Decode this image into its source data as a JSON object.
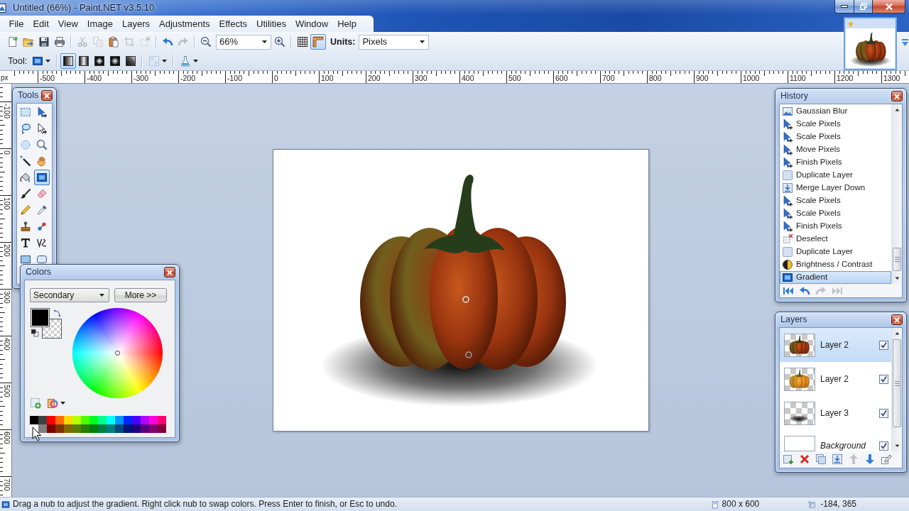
{
  "window": {
    "title": "Untitled (66%) - Paint.NET v3.5.10"
  },
  "menu": [
    "File",
    "Edit",
    "View",
    "Image",
    "Layers",
    "Adjustments",
    "Effects",
    "Utilities",
    "Window",
    "Help"
  ],
  "toolbar": {
    "groups": [
      [
        {
          "kind": "new",
          "disabled": false
        },
        {
          "kind": "open",
          "disabled": false
        },
        {
          "kind": "save",
          "disabled": false
        },
        {
          "kind": "print",
          "disabled": false
        }
      ],
      [
        {
          "kind": "cut",
          "disabled": true
        },
        {
          "kind": "copy",
          "disabled": true
        },
        {
          "kind": "paste",
          "disabled": false
        },
        {
          "kind": "crop",
          "disabled": true
        },
        {
          "kind": "deselect",
          "disabled": true
        }
      ],
      [
        {
          "kind": "undo",
          "disabled": false
        },
        {
          "kind": "redo",
          "disabled": true
        }
      ]
    ],
    "zoom": "66%",
    "grid_on": false,
    "rulers_on": true,
    "units_label": "Units:",
    "units": "Pixels"
  },
  "tool_options": {
    "label": "Tool:",
    "gradient_types": [
      {
        "kind": "linear",
        "selected": true
      },
      {
        "kind": "reflected",
        "selected": false
      },
      {
        "kind": "diamond",
        "selected": false
      },
      {
        "kind": "radial",
        "selected": false
      },
      {
        "kind": "conical",
        "selected": false
      }
    ]
  },
  "rulers": {
    "unit": "px",
    "horizontal": [
      "-500",
      "-400",
      "-300",
      "-200",
      "-100",
      "0",
      "100",
      "200",
      "300",
      "400",
      "500",
      "600",
      "700",
      "800",
      "900",
      "1000",
      "1100",
      "1200",
      "1300"
    ],
    "vertical": [
      "-100",
      "0",
      "100",
      "200",
      "300",
      "400",
      "500",
      "600",
      "700"
    ]
  },
  "tools_window": {
    "title": "Tools",
    "tools": [
      {
        "kind": "rectangle-select",
        "selected": false
      },
      {
        "kind": "move-pixels",
        "selected": false
      },
      {
        "kind": "lasso-select",
        "selected": false
      },
      {
        "kind": "move-selection",
        "selected": false
      },
      {
        "kind": "ellipse-select",
        "selected": false
      },
      {
        "kind": "zoom",
        "selected": false
      },
      {
        "kind": "magic-wand",
        "selected": false
      },
      {
        "kind": "pan",
        "selected": false
      },
      {
        "kind": "paint-bucket",
        "selected": false
      },
      {
        "kind": "gradient",
        "selected": true
      },
      {
        "kind": "paintbrush",
        "selected": false
      },
      {
        "kind": "eraser",
        "selected": false
      },
      {
        "kind": "pencil",
        "selected": false
      },
      {
        "kind": "color-picker",
        "selected": false
      },
      {
        "kind": "clone-stamp",
        "selected": false
      },
      {
        "kind": "recolor",
        "selected": false
      },
      {
        "kind": "text",
        "selected": false
      },
      {
        "kind": "line-curve",
        "selected": false
      },
      {
        "kind": "rectangle",
        "selected": false
      },
      {
        "kind": "rounded-rectangle",
        "selected": false
      }
    ]
  },
  "colors_window": {
    "title": "Colors",
    "mode": "Secondary",
    "more_button": "More >>",
    "palette": [
      {
        "color": "#000000"
      },
      {
        "color": "#404040"
      },
      {
        "color": "#ff0000"
      },
      {
        "color": "#ff6a00"
      },
      {
        "color": "#ffd800"
      },
      {
        "color": "#b6ff00"
      },
      {
        "color": "#4cff00"
      },
      {
        "color": "#00ff21"
      },
      {
        "color": "#00ff90"
      },
      {
        "color": "#00ffff"
      },
      {
        "color": "#0094ff"
      },
      {
        "color": "#0026ff"
      },
      {
        "color": "#4800ff"
      },
      {
        "color": "#b200ff"
      },
      {
        "color": "#ff00dc"
      },
      {
        "color": "#ff006e"
      },
      {
        "color": "#ffffff"
      },
      {
        "color": "#808080"
      },
      {
        "color": "#7f0000"
      },
      {
        "color": "#7f3300"
      },
      {
        "color": "#7f6a00"
      },
      {
        "color": "#5b7f00"
      },
      {
        "color": "#267f00"
      },
      {
        "color": "#007f0e"
      },
      {
        "color": "#007f46"
      },
      {
        "color": "#007f7f"
      },
      {
        "color": "#004a7f"
      },
      {
        "color": "#00137f"
      },
      {
        "color": "#21007f"
      },
      {
        "color": "#57007f"
      },
      {
        "color": "#7f006e"
      },
      {
        "color": "#7f0037"
      }
    ]
  },
  "history_window": {
    "title": "History",
    "items": [
      {
        "kind": "effect",
        "label": "Gaussian Blur",
        "selected": false
      },
      {
        "kind": "move-pixels",
        "label": "Scale Pixels",
        "selected": false
      },
      {
        "kind": "move-pixels",
        "label": "Scale Pixels",
        "selected": false
      },
      {
        "kind": "move-pixels",
        "label": "Move Pixels",
        "selected": false
      },
      {
        "kind": "move-pixels",
        "label": "Finish Pixels",
        "selected": false
      },
      {
        "kind": "layer",
        "label": "Duplicate Layer",
        "selected": false
      },
      {
        "kind": "merge-down",
        "label": "Merge Layer Down",
        "selected": false
      },
      {
        "kind": "move-pixels",
        "label": "Scale Pixels",
        "selected": false
      },
      {
        "kind": "move-pixels",
        "label": "Scale Pixels",
        "selected": false
      },
      {
        "kind": "move-pixels",
        "label": "Finish Pixels",
        "selected": false
      },
      {
        "kind": "deselect",
        "label": "Deselect",
        "selected": false
      },
      {
        "kind": "layer",
        "label": "Duplicate Layer",
        "selected": false
      },
      {
        "kind": "adjustment",
        "label": "Brightness / Contrast",
        "selected": false
      },
      {
        "kind": "gradient",
        "label": "Gradient",
        "selected": true
      }
    ],
    "nav": [
      {
        "kind": "first",
        "disabled": false
      },
      {
        "kind": "undo",
        "disabled": false
      },
      {
        "kind": "redo",
        "disabled": true
      },
      {
        "kind": "last",
        "disabled": true
      }
    ]
  },
  "layers_window": {
    "title": "Layers",
    "layers": [
      {
        "kind": "pumpkin-dark",
        "name": "Layer 2",
        "visible": true,
        "selected": true,
        "italic": false
      },
      {
        "kind": "pumpkin-orange",
        "name": "Layer 2",
        "visible": true,
        "selected": false,
        "italic": false
      },
      {
        "kind": "shadow",
        "name": "Layer 3",
        "visible": true,
        "selected": false,
        "italic": false
      },
      {
        "kind": "blank",
        "name": "Background",
        "visible": true,
        "selected": false,
        "italic": true
      }
    ],
    "buttons": [
      {
        "kind": "add-layer",
        "disabled": false
      },
      {
        "kind": "delete-layer",
        "disabled": false
      },
      {
        "kind": "duplicate-layer",
        "disabled": false
      },
      {
        "kind": "merge-down",
        "disabled": false
      },
      {
        "kind": "move-up",
        "disabled": true
      },
      {
        "kind": "move-down",
        "disabled": false
      },
      {
        "kind": "properties",
        "disabled": false
      }
    ]
  },
  "status_bar": {
    "hint": "Drag a nub to adjust the gradient. Right click nub to swap colors. Press Enter to finish, or Esc to undo.",
    "size": "800 x 600",
    "cursor": "-184, 365"
  }
}
